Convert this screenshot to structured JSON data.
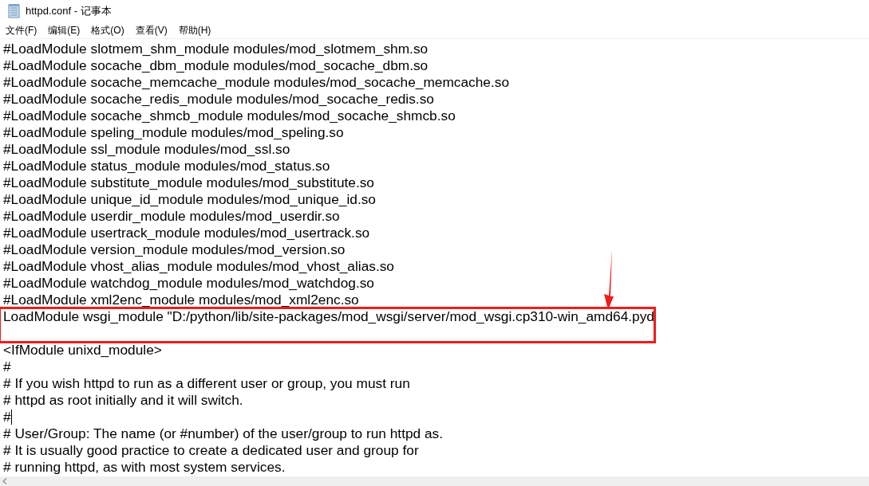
{
  "window": {
    "title": "httpd.conf - 记事本"
  },
  "menu": [
    "文件(F)",
    "编辑(E)",
    "格式(O)",
    "查看(V)",
    "帮助(H)"
  ],
  "lines": [
    {
      "text": "#LoadModule slotmem_shm_module modules/mod_slotmem_shm.so",
      "boxed": false,
      "caret": false
    },
    {
      "text": "#LoadModule socache_dbm_module modules/mod_socache_dbm.so",
      "boxed": false,
      "caret": false
    },
    {
      "text": "#LoadModule socache_memcache_module modules/mod_socache_memcache.so",
      "boxed": false,
      "caret": false
    },
    {
      "text": "#LoadModule socache_redis_module modules/mod_socache_redis.so",
      "boxed": false,
      "caret": false
    },
    {
      "text": "#LoadModule socache_shmcb_module modules/mod_socache_shmcb.so",
      "boxed": false,
      "caret": false
    },
    {
      "text": "#LoadModule speling_module modules/mod_speling.so",
      "boxed": false,
      "caret": false
    },
    {
      "text": "#LoadModule ssl_module modules/mod_ssl.so",
      "boxed": false,
      "caret": false
    },
    {
      "text": "#LoadModule status_module modules/mod_status.so",
      "boxed": false,
      "caret": false
    },
    {
      "text": "#LoadModule substitute_module modules/mod_substitute.so",
      "boxed": false,
      "caret": false
    },
    {
      "text": "#LoadModule unique_id_module modules/mod_unique_id.so",
      "boxed": false,
      "caret": false
    },
    {
      "text": "#LoadModule userdir_module modules/mod_userdir.so",
      "boxed": false,
      "caret": false
    },
    {
      "text": "#LoadModule usertrack_module modules/mod_usertrack.so",
      "boxed": false,
      "caret": false
    },
    {
      "text": "#LoadModule version_module modules/mod_version.so",
      "boxed": false,
      "caret": false
    },
    {
      "text": "#LoadModule vhost_alias_module modules/mod_vhost_alias.so",
      "boxed": false,
      "caret": false
    },
    {
      "text": "#LoadModule watchdog_module modules/mod_watchdog.so",
      "boxed": false,
      "caret": false
    },
    {
      "text": "#LoadModule xml2enc_module modules/mod_xml2enc.so",
      "boxed": false,
      "caret": false
    },
    {
      "text": "LoadModule wsgi_module \"D:/python/lib/site-packages/mod_wsgi/server/mod_wsgi.cp310-win_amd64.pyd",
      "boxed": true,
      "caret": false
    },
    {
      "boxed": true,
      "caret": false
    },
    {
      "text": "<IfModule unixd_module>",
      "boxed": false,
      "caret": false
    },
    {
      "text": "#",
      "boxed": false,
      "caret": false
    },
    {
      "text": "# If you wish httpd to run as a different user or group, you must run",
      "boxed": false,
      "caret": false
    },
    {
      "text": "# httpd as root initially and it will switch.",
      "boxed": false,
      "caret": false
    },
    {
      "text": "#",
      "boxed": false,
      "caret": true
    },
    {
      "text": "# User/Group: The name (or #number) of the user/group to run httpd as.",
      "boxed": false,
      "caret": false
    },
    {
      "text": "# It is usually good practice to create a dedicated user and group for",
      "boxed": false,
      "caret": false
    },
    {
      "text": "# running httpd, as with most system services.",
      "boxed": false,
      "caret": false
    }
  ]
}
